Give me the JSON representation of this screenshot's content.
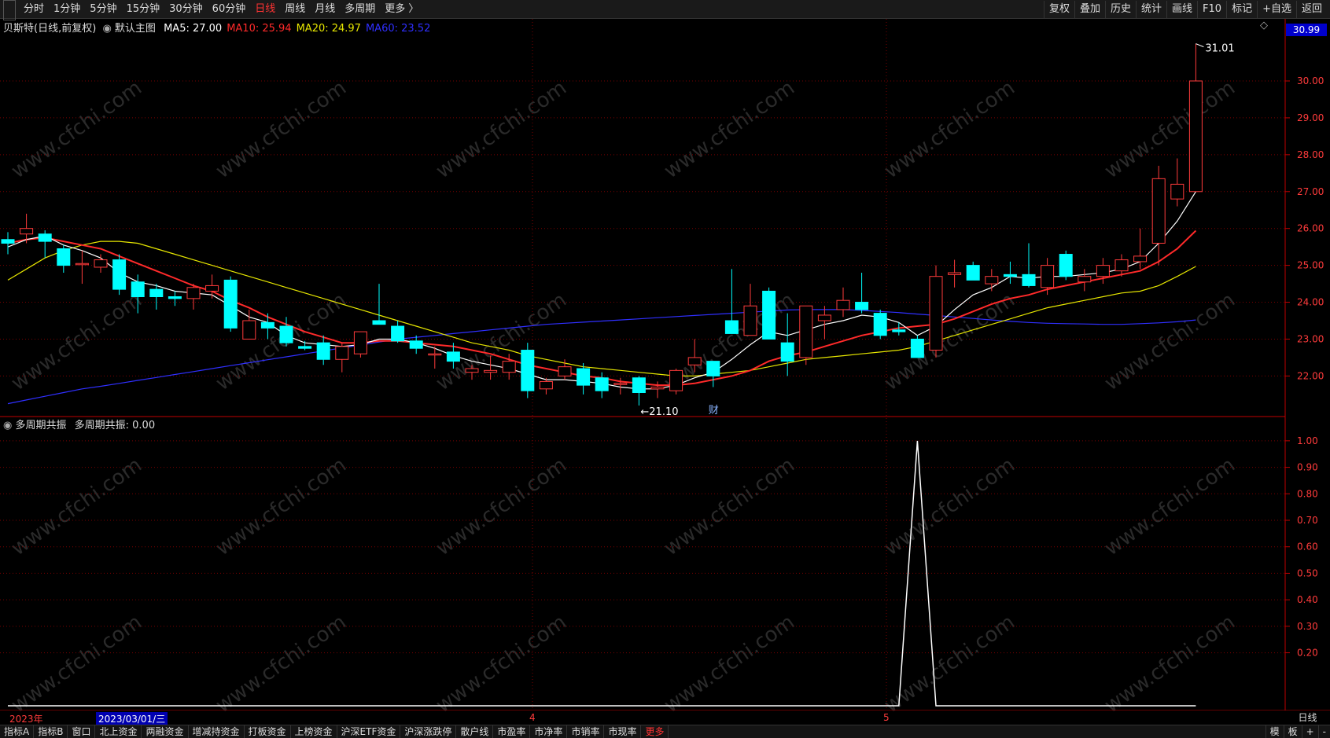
{
  "topbar": {
    "periods": [
      "分时",
      "1分钟",
      "5分钟",
      "15分钟",
      "30分钟",
      "60分钟",
      "日线",
      "周线",
      "月线",
      "多周期",
      "更多 〉"
    ],
    "active_period": "日线",
    "right_buttons": [
      "复权",
      "叠加",
      "历史",
      "统计",
      "画线",
      "F10",
      "标记",
      "+自选",
      "返回"
    ]
  },
  "main_panel": {
    "stock_name": "贝斯特",
    "chart_mode": "(日线,前复权)",
    "indicator_name": "默认主图",
    "ma_legend": [
      {
        "label": "MA5: 27.00",
        "color": "#ffffff"
      },
      {
        "label": "MA10: 25.94",
        "color": "#ff2a2a"
      },
      {
        "label": "MA20: 24.97",
        "color": "#e6e600"
      },
      {
        "label": "MA60: 23.52",
        "color": "#2f2fff"
      }
    ],
    "current_price_tag": "30.99",
    "high_label": "31.01",
    "low_label": "21.10",
    "event_marker": "财",
    "top_right_icon": "◇"
  },
  "sub_panel": {
    "indicator_name": "多周期共振",
    "value_label": "多周期共振: 0.00",
    "line_color": "#ffffff"
  },
  "date_axis": {
    "start_year": "2023年",
    "cursor_date": "2023/03/01/三",
    "month_4": "4",
    "month_5": "5",
    "period_label": "日线"
  },
  "bottombar": {
    "tabs": [
      "指标A",
      "指标B",
      "窗口",
      "北上资金",
      "两融资金",
      "增减持资金",
      "打板资金",
      "上榜资金",
      "沪深ETF资金",
      "沪深涨跌停",
      "散户线",
      "市盈率",
      "市净率",
      "市销率",
      "市现率",
      "更多"
    ],
    "right_buttons": [
      "模",
      "板",
      "+",
      "-"
    ]
  },
  "watermark": "www.cfchi.com",
  "colors": {
    "up": "#ff3b3b",
    "down": "#00ffff",
    "grid": "#7a0000",
    "axis_text": "#ff3b3b",
    "price_tag_bg": "#0000cc"
  },
  "chart_data": [
    {
      "type": "candlestick",
      "title": "",
      "ylim": [
        20.9,
        31.3
      ],
      "y_ticks": [
        "30.00",
        "29.00",
        "28.00",
        "27.00",
        "26.00",
        "25.00",
        "24.00",
        "23.00",
        "22.00"
      ],
      "candles": [
        {
          "o": 25.7,
          "h": 25.9,
          "l": 25.3,
          "c": 25.6
        },
        {
          "o": 25.85,
          "h": 26.4,
          "l": 25.6,
          "c": 26.0
        },
        {
          "o": 25.85,
          "h": 25.95,
          "l": 25.2,
          "c": 25.65
        },
        {
          "o": 25.45,
          "h": 25.55,
          "l": 24.8,
          "c": 25.0
        },
        {
          "o": 25.05,
          "h": 25.4,
          "l": 24.5,
          "c": 25.05
        },
        {
          "o": 24.95,
          "h": 25.3,
          "l": 24.8,
          "c": 25.15
        },
        {
          "o": 25.15,
          "h": 25.3,
          "l": 24.2,
          "c": 24.35
        },
        {
          "o": 24.55,
          "h": 24.75,
          "l": 23.7,
          "c": 24.15
        },
        {
          "o": 24.35,
          "h": 24.5,
          "l": 23.8,
          "c": 24.15
        },
        {
          "o": 24.15,
          "h": 24.3,
          "l": 23.9,
          "c": 24.1
        },
        {
          "o": 24.1,
          "h": 24.5,
          "l": 23.8,
          "c": 24.4
        },
        {
          "o": 24.3,
          "h": 24.75,
          "l": 24.1,
          "c": 24.45
        },
        {
          "o": 24.6,
          "h": 24.7,
          "l": 23.2,
          "c": 23.3
        },
        {
          "o": 23.0,
          "h": 23.8,
          "l": 23.0,
          "c": 23.5
        },
        {
          "o": 23.45,
          "h": 23.7,
          "l": 23.0,
          "c": 23.3
        },
        {
          "o": 23.35,
          "h": 23.6,
          "l": 22.8,
          "c": 22.9
        },
        {
          "o": 22.8,
          "h": 22.95,
          "l": 22.7,
          "c": 22.75
        },
        {
          "o": 22.9,
          "h": 23.1,
          "l": 22.3,
          "c": 22.45
        },
        {
          "o": 22.45,
          "h": 22.9,
          "l": 22.1,
          "c": 22.8
        },
        {
          "o": 22.6,
          "h": 23.1,
          "l": 22.5,
          "c": 23.2
        },
        {
          "o": 23.5,
          "h": 24.5,
          "l": 23.4,
          "c": 23.4
        },
        {
          "o": 23.35,
          "h": 23.5,
          "l": 22.9,
          "c": 22.95
        },
        {
          "o": 22.95,
          "h": 23.1,
          "l": 22.6,
          "c": 22.75
        },
        {
          "o": 22.6,
          "h": 22.8,
          "l": 22.2,
          "c": 22.6
        },
        {
          "o": 22.65,
          "h": 22.9,
          "l": 22.2,
          "c": 22.4
        },
        {
          "o": 22.1,
          "h": 22.3,
          "l": 21.9,
          "c": 22.2
        },
        {
          "o": 22.1,
          "h": 22.55,
          "l": 21.9,
          "c": 22.15
        },
        {
          "o": 22.1,
          "h": 22.6,
          "l": 21.9,
          "c": 22.4
        },
        {
          "o": 22.7,
          "h": 22.9,
          "l": 21.4,
          "c": 21.6
        },
        {
          "o": 21.65,
          "h": 21.95,
          "l": 21.5,
          "c": 21.85
        },
        {
          "o": 22.0,
          "h": 22.45,
          "l": 21.9,
          "c": 22.25
        },
        {
          "o": 22.2,
          "h": 22.35,
          "l": 21.5,
          "c": 21.75
        },
        {
          "o": 21.95,
          "h": 22.1,
          "l": 21.4,
          "c": 21.6
        },
        {
          "o": 21.8,
          "h": 21.95,
          "l": 21.5,
          "c": 21.8
        },
        {
          "o": 21.95,
          "h": 22.0,
          "l": 21.2,
          "c": 21.55
        },
        {
          "o": 21.65,
          "h": 21.85,
          "l": 21.4,
          "c": 21.7
        },
        {
          "o": 21.6,
          "h": 22.2,
          "l": 21.5,
          "c": 22.15
        },
        {
          "o": 22.3,
          "h": 23.0,
          "l": 22.1,
          "c": 22.5
        },
        {
          "o": 22.4,
          "h": 22.4,
          "l": 21.7,
          "c": 22.0
        },
        {
          "o": 23.5,
          "h": 24.9,
          "l": 23.3,
          "c": 23.15
        },
        {
          "o": 23.1,
          "h": 24.5,
          "l": 23.1,
          "c": 23.9
        },
        {
          "o": 24.3,
          "h": 24.4,
          "l": 23.0,
          "c": 23.0
        },
        {
          "o": 22.9,
          "h": 23.7,
          "l": 22.0,
          "c": 22.4
        },
        {
          "o": 22.5,
          "h": 23.9,
          "l": 22.3,
          "c": 23.9
        },
        {
          "o": 23.5,
          "h": 23.9,
          "l": 23.0,
          "c": 23.65
        },
        {
          "o": 23.8,
          "h": 24.4,
          "l": 23.6,
          "c": 24.05
        },
        {
          "o": 24.0,
          "h": 24.8,
          "l": 23.7,
          "c": 23.8
        },
        {
          "o": 23.7,
          "h": 23.8,
          "l": 23.0,
          "c": 23.1
        },
        {
          "o": 23.25,
          "h": 23.45,
          "l": 23.1,
          "c": 23.2
        },
        {
          "o": 23.0,
          "h": 23.1,
          "l": 22.5,
          "c": 22.5
        },
        {
          "o": 22.7,
          "h": 25.0,
          "l": 22.5,
          "c": 24.7
        },
        {
          "o": 24.75,
          "h": 25.15,
          "l": 24.4,
          "c": 24.8
        },
        {
          "o": 25.0,
          "h": 25.1,
          "l": 24.6,
          "c": 24.6
        },
        {
          "o": 24.5,
          "h": 24.9,
          "l": 24.3,
          "c": 24.7
        },
        {
          "o": 24.75,
          "h": 25.1,
          "l": 24.5,
          "c": 24.7
        },
        {
          "o": 24.75,
          "h": 25.6,
          "l": 24.4,
          "c": 24.45
        },
        {
          "o": 24.4,
          "h": 25.2,
          "l": 24.2,
          "c": 25.0
        },
        {
          "o": 25.3,
          "h": 25.4,
          "l": 24.6,
          "c": 24.7
        },
        {
          "o": 24.55,
          "h": 24.9,
          "l": 24.3,
          "c": 24.7
        },
        {
          "o": 24.7,
          "h": 25.2,
          "l": 24.5,
          "c": 25.0
        },
        {
          "o": 24.85,
          "h": 25.3,
          "l": 24.7,
          "c": 25.15
        },
        {
          "o": 25.1,
          "h": 26.0,
          "l": 24.9,
          "c": 25.25
        },
        {
          "o": 25.6,
          "h": 27.7,
          "l": 25.0,
          "c": 27.35
        },
        {
          "o": 26.8,
          "h": 27.9,
          "l": 26.6,
          "c": 27.2
        },
        {
          "o": 27.0,
          "h": 31.01,
          "l": 27.0,
          "c": 30.0
        }
      ],
      "ma5": [
        25.5,
        25.7,
        25.8,
        25.55,
        25.4,
        25.2,
        24.8,
        24.55,
        24.45,
        24.3,
        24.25,
        24.2,
        23.9,
        23.6,
        23.45,
        23.1,
        22.9,
        22.85,
        22.8,
        22.85,
        23.0,
        23.0,
        22.9,
        22.75,
        22.55,
        22.4,
        22.3,
        22.2,
        22.05,
        21.9,
        21.9,
        21.85,
        21.8,
        21.7,
        21.65,
        21.65,
        21.75,
        21.95,
        22.1,
        22.45,
        22.85,
        23.2,
        23.1,
        23.25,
        23.4,
        23.5,
        23.65,
        23.6,
        23.45,
        23.1,
        23.35,
        23.8,
        24.2,
        24.4,
        24.7,
        24.65,
        24.7,
        24.7,
        24.75,
        24.8,
        24.9,
        25.1,
        25.6,
        26.2,
        27.0
      ],
      "ma10": [
        25.6,
        25.7,
        25.75,
        25.65,
        25.55,
        25.45,
        25.25,
        25.05,
        24.85,
        24.65,
        24.45,
        24.3,
        24.05,
        23.85,
        23.6,
        23.4,
        23.2,
        23.05,
        22.9,
        22.9,
        22.95,
        22.95,
        22.9,
        22.85,
        22.8,
        22.7,
        22.6,
        22.45,
        22.3,
        22.2,
        22.1,
        22.0,
        21.95,
        21.85,
        21.8,
        21.75,
        21.75,
        21.8,
        21.9,
        22.0,
        22.15,
        22.4,
        22.55,
        22.65,
        22.8,
        22.95,
        23.1,
        23.2,
        23.3,
        23.35,
        23.4,
        23.55,
        23.75,
        23.95,
        24.1,
        24.2,
        24.35,
        24.45,
        24.55,
        24.65,
        24.75,
        24.85,
        25.1,
        25.45,
        25.94
      ],
      "ma20": [
        24.6,
        24.9,
        25.2,
        25.4,
        25.55,
        25.65,
        25.65,
        25.6,
        25.45,
        25.3,
        25.15,
        25.0,
        24.85,
        24.7,
        24.55,
        24.4,
        24.25,
        24.1,
        23.95,
        23.8,
        23.65,
        23.5,
        23.35,
        23.2,
        23.05,
        22.9,
        22.8,
        22.7,
        22.55,
        22.45,
        22.35,
        22.25,
        22.2,
        22.15,
        22.1,
        22.05,
        22.0,
        22.0,
        22.05,
        22.1,
        22.15,
        22.25,
        22.35,
        22.45,
        22.5,
        22.55,
        22.6,
        22.65,
        22.7,
        22.8,
        22.95,
        23.1,
        23.25,
        23.4,
        23.55,
        23.7,
        23.85,
        23.95,
        24.05,
        24.15,
        24.25,
        24.3,
        24.45,
        24.7,
        24.97
      ],
      "ma60": [
        21.25,
        21.35,
        21.45,
        21.55,
        21.65,
        21.72,
        21.8,
        21.88,
        21.96,
        22.04,
        22.12,
        22.2,
        22.28,
        22.36,
        22.44,
        22.52,
        22.6,
        22.68,
        22.76,
        22.84,
        22.92,
        23.0,
        23.05,
        23.1,
        23.15,
        23.2,
        23.25,
        23.3,
        23.35,
        23.4,
        23.43,
        23.46,
        23.49,
        23.52,
        23.55,
        23.58,
        23.61,
        23.64,
        23.67,
        23.7,
        23.73,
        23.76,
        23.79,
        23.8,
        23.8,
        23.8,
        23.78,
        23.75,
        23.72,
        23.68,
        23.64,
        23.6,
        23.56,
        23.52,
        23.48,
        23.45,
        23.43,
        23.42,
        23.41,
        23.4,
        23.4,
        23.42,
        23.44,
        23.47,
        23.52
      ]
    },
    {
      "type": "line",
      "title": "",
      "ylim": [
        0,
        1.05
      ],
      "y_ticks": [
        "1.00",
        "0.90",
        "0.80",
        "0.70",
        "0.60",
        "0.50",
        "0.40",
        "0.30",
        "0.20"
      ],
      "values": [
        0,
        0,
        0,
        0,
        0,
        0,
        0,
        0,
        0,
        0,
        0,
        0,
        0,
        0,
        0,
        0,
        0,
        0,
        0,
        0,
        0,
        0,
        0,
        0,
        0,
        0,
        0,
        0,
        0,
        0,
        0,
        0,
        0,
        0,
        0,
        0,
        0,
        0,
        0,
        0,
        0,
        0,
        0,
        0,
        0,
        0,
        0,
        0,
        0,
        1,
        0,
        0,
        0,
        0,
        0,
        0,
        0,
        0,
        0,
        0,
        0,
        0,
        0,
        0,
        0
      ]
    }
  ]
}
